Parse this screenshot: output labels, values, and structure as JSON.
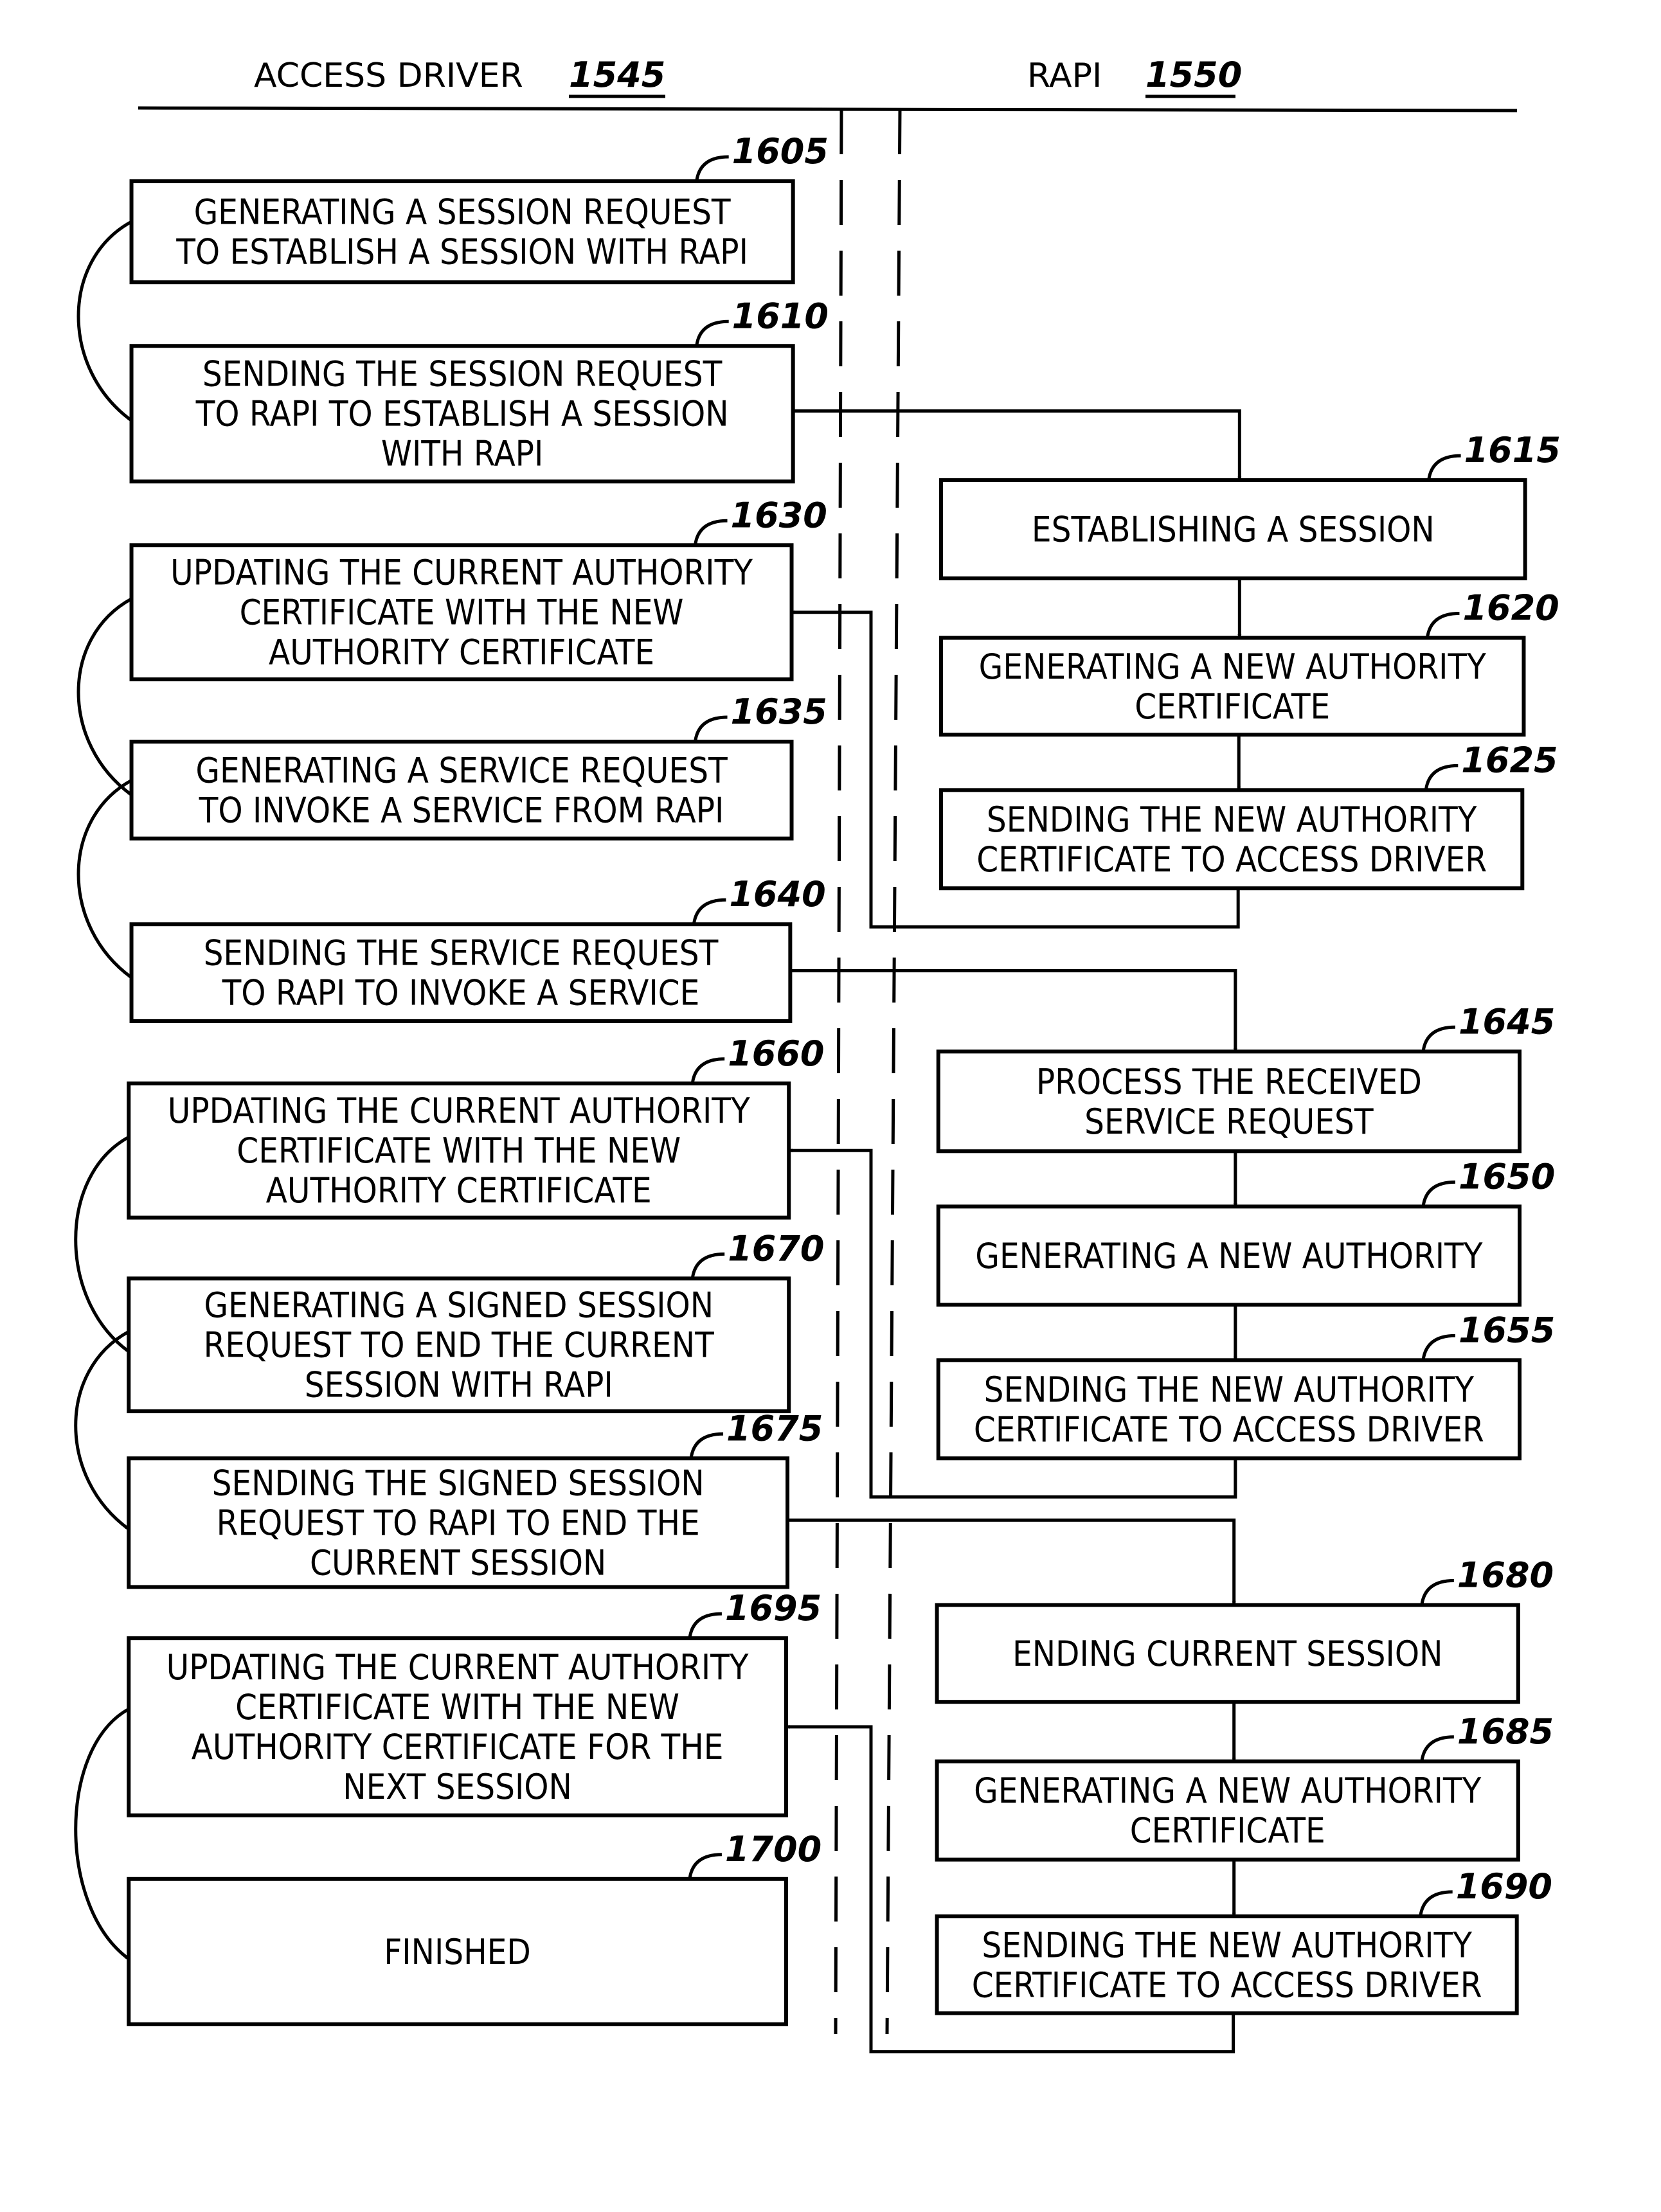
{
  "header": {
    "left_label": "ACCESS DRIVER",
    "left_ref": "1545",
    "right_label": "RAPI",
    "right_ref": "1550"
  },
  "steps": [
    {
      "ref": "1605",
      "lane": "access_driver",
      "lines": [
        "GENERATING A SESSION REQUEST",
        "TO ESTABLISH A SESSION WITH RAPI"
      ]
    },
    {
      "ref": "1610",
      "lane": "access_driver",
      "lines": [
        "SENDING THE SESSION REQUEST",
        "TO RAPI TO ESTABLISH A SESSION",
        "WITH RAPI"
      ]
    },
    {
      "ref": "1615",
      "lane": "rapi",
      "lines": [
        "ESTABLISHING A SESSION"
      ]
    },
    {
      "ref": "1620",
      "lane": "rapi",
      "lines": [
        "GENERATING A NEW AUTHORITY",
        "CERTIFICATE"
      ]
    },
    {
      "ref": "1625",
      "lane": "rapi",
      "lines": [
        "SENDING THE NEW AUTHORITY",
        "CERTIFICATE TO ACCESS DRIVER"
      ]
    },
    {
      "ref": "1630",
      "lane": "access_driver",
      "lines": [
        "UPDATING THE CURRENT AUTHORITY",
        "CERTIFICATE WITH THE NEW",
        "AUTHORITY CERTIFICATE"
      ]
    },
    {
      "ref": "1635",
      "lane": "access_driver",
      "lines": [
        "GENERATING A SERVICE REQUEST",
        "TO INVOKE A SERVICE FROM RAPI"
      ]
    },
    {
      "ref": "1640",
      "lane": "access_driver",
      "lines": [
        "SENDING THE SERVICE REQUEST",
        "TO RAPI TO INVOKE A SERVICE"
      ]
    },
    {
      "ref": "1645",
      "lane": "rapi",
      "lines": [
        "PROCESS THE RECEIVED",
        "SERVICE REQUEST"
      ]
    },
    {
      "ref": "1650",
      "lane": "rapi",
      "lines": [
        "GENERATING A NEW AUTHORITY"
      ]
    },
    {
      "ref": "1655",
      "lane": "rapi",
      "lines": [
        "SENDING THE NEW AUTHORITY",
        "CERTIFICATE TO ACCESS DRIVER"
      ]
    },
    {
      "ref": "1660",
      "lane": "access_driver",
      "lines": [
        "UPDATING THE CURRENT AUTHORITY",
        "CERTIFICATE WITH THE NEW",
        "AUTHORITY CERTIFICATE"
      ]
    },
    {
      "ref": "1670",
      "lane": "access_driver",
      "lines": [
        "GENERATING A SIGNED SESSION",
        "REQUEST TO END THE CURRENT",
        "SESSION WITH RAPI"
      ]
    },
    {
      "ref": "1675",
      "lane": "access_driver",
      "lines": [
        "SENDING THE SIGNED SESSION",
        "REQUEST TO RAPI TO END THE",
        "CURRENT SESSION"
      ]
    },
    {
      "ref": "1680",
      "lane": "rapi",
      "lines": [
        "ENDING CURRENT SESSION"
      ]
    },
    {
      "ref": "1685",
      "lane": "rapi",
      "lines": [
        "GENERATING A NEW AUTHORITY",
        "CERTIFICATE"
      ]
    },
    {
      "ref": "1690",
      "lane": "rapi",
      "lines": [
        "SENDING THE NEW AUTHORITY",
        "CERTIFICATE TO ACCESS DRIVER"
      ]
    },
    {
      "ref": "1695",
      "lane": "access_driver",
      "lines": [
        "UPDATING THE CURRENT AUTHORITY",
        "CERTIFICATE WITH THE NEW",
        "AUTHORITY CERTIFICATE FOR THE",
        "NEXT SESSION"
      ]
    },
    {
      "ref": "1700",
      "lane": "access_driver",
      "lines": [
        "FINISHED"
      ]
    }
  ],
  "flows": [
    {
      "from": "1605",
      "to": "1610",
      "kind": "curve"
    },
    {
      "from": "1610",
      "to": "1615",
      "kind": "cross"
    },
    {
      "from": "1615",
      "to": "1620",
      "kind": "down"
    },
    {
      "from": "1620",
      "to": "1625",
      "kind": "down"
    },
    {
      "from": "1625",
      "to": "1630",
      "kind": "return"
    },
    {
      "from": "1630",
      "to": "1635",
      "kind": "curve"
    },
    {
      "from": "1635",
      "to": "1640",
      "kind": "curve"
    },
    {
      "from": "1640",
      "to": "1645",
      "kind": "cross"
    },
    {
      "from": "1645",
      "to": "1650",
      "kind": "down"
    },
    {
      "from": "1650",
      "to": "1655",
      "kind": "down"
    },
    {
      "from": "1655",
      "to": "1660",
      "kind": "return"
    },
    {
      "from": "1660",
      "to": "1670",
      "kind": "curve"
    },
    {
      "from": "1670",
      "to": "1675",
      "kind": "curve"
    },
    {
      "from": "1675",
      "to": "1680",
      "kind": "cross"
    },
    {
      "from": "1680",
      "to": "1685",
      "kind": "down"
    },
    {
      "from": "1685",
      "to": "1690",
      "kind": "down"
    },
    {
      "from": "1690",
      "to": "1695",
      "kind": "return"
    },
    {
      "from": "1695",
      "to": "1700",
      "kind": "curve"
    }
  ]
}
